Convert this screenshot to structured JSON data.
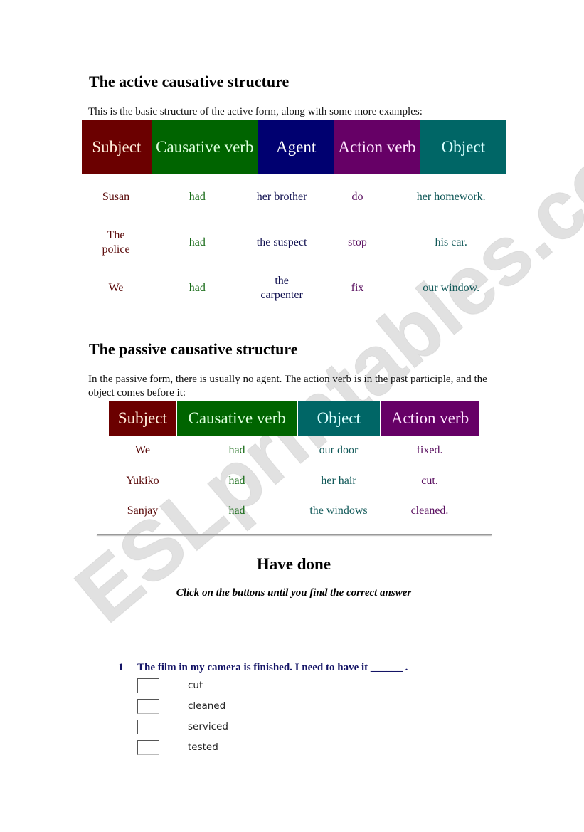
{
  "active_section": {
    "title": "The active causative structure",
    "intro": "This is the basic structure of the active form, along with some more examples:",
    "headers": [
      "Subject",
      "Causative verb",
      "Agent",
      "Action verb",
      "Object"
    ],
    "rows": [
      [
        "Susan",
        "had",
        "her brother",
        "do",
        "her homework."
      ],
      [
        "The police",
        "had",
        "the suspect",
        "stop",
        "his car."
      ],
      [
        "We",
        "had",
        "the carpenter",
        "fix",
        "our window."
      ]
    ]
  },
  "passive_section": {
    "title": "The passive causative structure",
    "intro": "In the passive form, there is usually no agent. The action verb is in the past participle, and the object comes before it:",
    "headers": [
      "Subject",
      "Causative verb",
      "Object",
      "Action verb"
    ],
    "rows": [
      [
        "We",
        "had",
        "our door",
        "fixed."
      ],
      [
        "Yukiko",
        "had",
        "her hair",
        "cut."
      ],
      [
        "Sanjay",
        "had",
        "the windows",
        "cleaned."
      ]
    ]
  },
  "quiz": {
    "title": "Have done",
    "instruction": "Click on the buttons until you find the correct answer",
    "questions": [
      {
        "number": "1",
        "text": "The film in my camera is finished. I need to have it ______ .",
        "options": [
          "cut",
          "cleaned",
          "serviced",
          "tested"
        ]
      }
    ]
  },
  "watermark": "ESLprintables.com",
  "colors": {
    "subject": "#6b0000",
    "causative": "#006400",
    "agent": "#000070",
    "action": "#660066",
    "object": "#006666"
  }
}
